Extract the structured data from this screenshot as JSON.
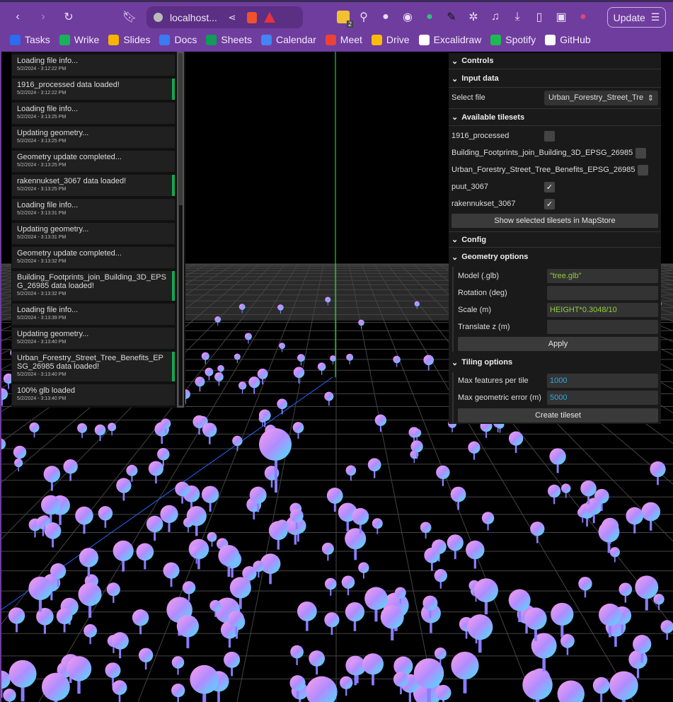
{
  "browser": {
    "url": "localhost...",
    "update_label": "Update",
    "extension_badge": "2",
    "bookmarks": [
      {
        "label": "Tasks",
        "color": "#2d6bf0"
      },
      {
        "label": "Wrike",
        "color": "#18b25a"
      },
      {
        "label": "Slides",
        "color": "#f6b400"
      },
      {
        "label": "Docs",
        "color": "#3b7bf2"
      },
      {
        "label": "Sheets",
        "color": "#0f9d58"
      },
      {
        "label": "Calendar",
        "color": "#4285f4"
      },
      {
        "label": "Meet",
        "color": "#ea4335"
      },
      {
        "label": "Drive",
        "color": "#fbbc04"
      },
      {
        "label": "Excalidraw",
        "color": "#ffffff"
      },
      {
        "label": "Spotify",
        "color": "#1db954"
      },
      {
        "label": "GitHub",
        "color": "#ffffff"
      }
    ]
  },
  "log": [
    {
      "msg": "Loading file info...",
      "time": "5/2/2024 - 3:12:22 PM",
      "ok": false
    },
    {
      "msg": "1916_processed data loaded!",
      "time": "5/2/2024 - 3:12:22 PM",
      "ok": true
    },
    {
      "msg": "Loading file info...",
      "time": "5/2/2024 - 3:13:25 PM",
      "ok": false
    },
    {
      "msg": "Updating geometry...",
      "time": "5/2/2024 - 3:13:25 PM",
      "ok": false
    },
    {
      "msg": "Geometry update completed...",
      "time": "5/2/2024 - 3:13:25 PM",
      "ok": false
    },
    {
      "msg": "rakennukset_3067 data loaded!",
      "time": "5/2/2024 - 3:13:25 PM",
      "ok": true
    },
    {
      "msg": "Loading file info...",
      "time": "5/2/2024 - 3:13:31 PM",
      "ok": false
    },
    {
      "msg": "Updating geometry...",
      "time": "5/2/2024 - 3:13:31 PM",
      "ok": false
    },
    {
      "msg": "Geometry update completed...",
      "time": "5/2/2024 - 3:13:32 PM",
      "ok": false
    },
    {
      "msg": "Building_Footprints_join_Building_3D_EPSG_26985 data loaded!",
      "time": "5/2/2024 - 3:13:32 PM",
      "ok": true
    },
    {
      "msg": "Loading file info...",
      "time": "5/2/2024 - 3:13:39 PM",
      "ok": false
    },
    {
      "msg": "Updating geometry...",
      "time": "5/2/2024 - 3:13:40 PM",
      "ok": false
    },
    {
      "msg": "Urban_Forestry_Street_Tree_Benefits_EPSG_26985 data loaded!",
      "time": "5/2/2024 - 3:13:40 PM",
      "ok": true
    },
    {
      "msg": "100% glb loaded",
      "time": "5/2/2024 - 3:13:40 PM",
      "ok": false
    }
  ],
  "panel": {
    "controls": "Controls",
    "input_data": "Input data",
    "select_file_label": "Select file",
    "select_file_value": "Urban_Forestry_Street_Tre",
    "available": "Available tilesets",
    "tilesets": [
      {
        "name": "1916_processed",
        "checked": false
      },
      {
        "name": "Building_Footprints_join_Building_3D_EPSG_26985",
        "checked": false
      },
      {
        "name": "Urban_Forestry_Street_Tree_Benefits_EPSG_26985",
        "checked": false
      },
      {
        "name": "puut_3067",
        "checked": true
      },
      {
        "name": "rakennukset_3067",
        "checked": true
      }
    ],
    "show_button": "Show selected tilesets in MapStore",
    "config": "Config",
    "geometry": "Geometry options",
    "geo_fields": [
      {
        "label": "Model (.glb)",
        "value": "\"tree.glb\""
      },
      {
        "label": "Rotation (deg)",
        "value": ""
      },
      {
        "label": "Scale (m)",
        "value": "HEIGHT*0.3048/10"
      },
      {
        "label": "Translate z (m)",
        "value": ""
      }
    ],
    "apply": "Apply",
    "tiling": "Tiling options",
    "tile_fields": [
      {
        "label": "Max features per tile",
        "value": "1000"
      },
      {
        "label": "Max geometric error (m)",
        "value": "5000"
      }
    ],
    "create": "Create tileset",
    "colors": {
      "string_value": "#8fce3a",
      "number_value": "#2fa8e0",
      "success": "#12a850"
    }
  }
}
